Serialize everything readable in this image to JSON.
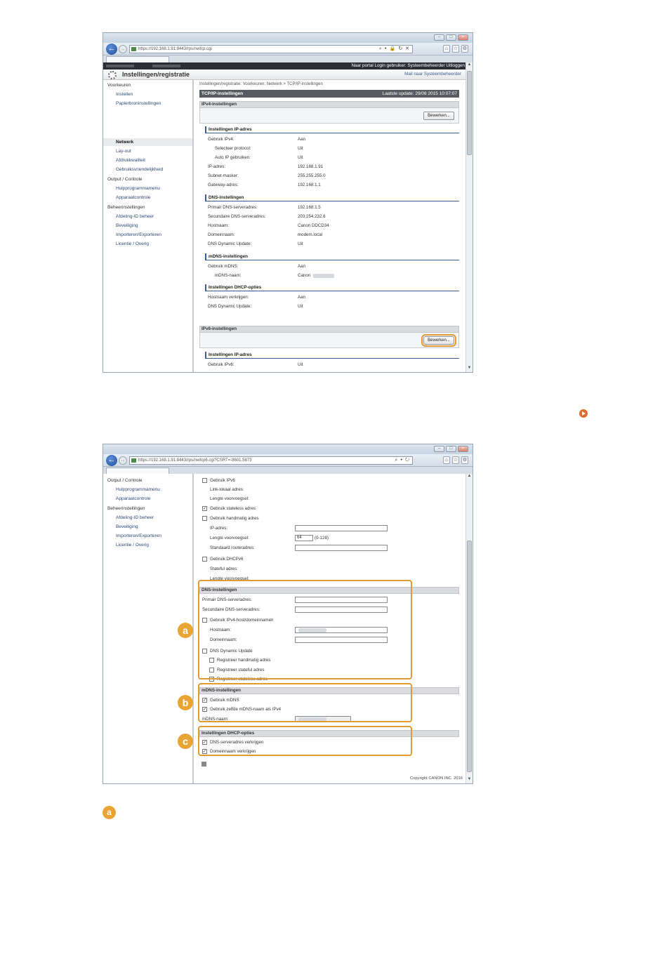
{
  "screenshot1": {
    "address": "https://192.168.1.91:8443/rps/nwtcp.cgi",
    "header_links": "Naar portal  Login gebruiker: Systeembeheerder  Uitloggen",
    "header_title": "Instellingen/registratie",
    "mail_link": "Mail naar Systeembeheerder",
    "sidebar": [
      {
        "label": "Voorkeuren",
        "type": "group"
      },
      {
        "label": "Instellen",
        "type": "item"
      },
      {
        "label": "Papierbroninstellingen",
        "type": "item"
      },
      {
        "label": "Netwerk",
        "type": "active"
      },
      {
        "label": "Lay-out",
        "type": "item"
      },
      {
        "label": "Afdrukkwaliteit",
        "type": "item"
      },
      {
        "label": "Gebruiksvriendelijkheid",
        "type": "item"
      },
      {
        "label": "Output / Controle",
        "type": "group"
      },
      {
        "label": "Hulpprogrammamenu",
        "type": "item"
      },
      {
        "label": "Apparaatcontrole",
        "type": "item"
      },
      {
        "label": "Beheerinstellingen",
        "type": "group"
      },
      {
        "label": "Afdeling-ID beheer",
        "type": "item"
      },
      {
        "label": "Beveiliging",
        "type": "item"
      },
      {
        "label": "Importeren/Exporteren",
        "type": "item"
      },
      {
        "label": "Licentie / Overig",
        "type": "item"
      }
    ],
    "breadcrumb": "Instellingen/registratie: Voorkeuren: Netwerk > TCP/IP-instellingen",
    "page_title": "TCP/IP-instellingen",
    "last_update": "Laatste update: 29/08 2015 10:07:07",
    "ipv4_section": "IPv4-instellingen",
    "edit_label": "Bewerken...",
    "ip_heading": "Instellingen IP-adres",
    "ip_rows": [
      {
        "label": "Gebruik IPv4:",
        "value": "Aan"
      },
      {
        "label": "Selecteer protocol:",
        "value": "Uit"
      },
      {
        "label": "Auto IP gebruiken:",
        "value": "Uit"
      },
      {
        "label": "IP-adres:",
        "value": "192.168.1.91"
      },
      {
        "label": "Subnet-masker:",
        "value": "255.255.255.0"
      },
      {
        "label": "Gateway-adres:",
        "value": "192.168.1.1"
      }
    ],
    "dns_heading": "DNS-instellingen",
    "dns_rows": [
      {
        "label": "Primair DNS-serveradres:",
        "value": "192.168.1.5"
      },
      {
        "label": "Secundaire DNS-serveradres:",
        "value": "203.254.232.6"
      },
      {
        "label": "Hostnaam:",
        "value": "Canon DDCD34"
      },
      {
        "label": "Domeinnaam:",
        "value": "modem.local"
      },
      {
        "label": "DNS Dynamic Update:",
        "value": "Uit"
      }
    ],
    "mdns_heading": "mDNS-instellingen",
    "mdns_rows": [
      {
        "label": "Gebruik mDNS:",
        "value": "Aan"
      },
      {
        "label": "mDNS-naam:",
        "value": "Canon"
      }
    ],
    "dhcp_heading": "Instellingen DHCP-opties",
    "dhcp_rows": [
      {
        "label": "Hostnaam verkrijgen:",
        "value": "Aan"
      },
      {
        "label": "DNS Dynamic Update:",
        "value": "Uit"
      }
    ],
    "ipv6_section": "IPv6-instellingen",
    "ip6_heading": "Instellingen IP-adres",
    "ip6_row": {
      "label": "Gebruik IPv6:",
      "value": "Uit"
    }
  },
  "screenshot2": {
    "address": "https://192.168.1.91:8443/rps/nwtcp6.cgi?CSRT=-8601.5873",
    "sidebar": [
      {
        "label": "Output / Controle",
        "type": "group"
      },
      {
        "label": "Hulpprogrammamenu",
        "type": "item"
      },
      {
        "label": "Apparaatcontrole",
        "type": "item"
      },
      {
        "label": "Beheerinstellingen",
        "type": "group"
      },
      {
        "label": "Afdeling-ID beheer",
        "type": "item"
      },
      {
        "label": "Beveiliging",
        "type": "item"
      },
      {
        "label": "Importeren/Exporteren",
        "type": "item"
      },
      {
        "label": "Licentie / Overig",
        "type": "item"
      }
    ],
    "ipv6": {
      "use_ipv6": "Gebruik IPv6",
      "link_local": "Link-lokaal adres:",
      "prefix_length1": "Lengte voorvoegsel:",
      "stateless": "Gebruik stateless adres",
      "manual": "Gebruik handmatig adres",
      "ip_address": "IP-adres:",
      "prefix_length2": "Lengte voorvoegsel:",
      "prefix_value": "64",
      "prefix_range": "(0-128)",
      "default_router": "Standaard routeradres:",
      "dhcpv6": "Gebruik DHCPv6",
      "stateful": "Stateful adres:",
      "prefix_length3": "Lengte voorvoegsel:"
    },
    "dns": {
      "heading": "DNS-instellingen",
      "primary": "Primair DNS-serveradres:",
      "secondary": "Secundaire DNS-serveradres:",
      "use_ipv4_host": "Gebruik IPv4-host/domeinnamen",
      "hostname": "Hostnaam:",
      "domain": "Domeinnaam:",
      "dynamic_update": "DNS Dynamic Update",
      "reg_manual": "Registreer handmatig adres",
      "reg_stateful": "Registreer stateful adres",
      "reg_stateless": "Registreer stateless adres"
    },
    "mdns": {
      "heading": "mDNS-instellingen",
      "use_mdns": "Gebruik mDNS",
      "same_name": "Gebruik zelfde mDNS-naam als IPv4",
      "name": "mDNS-naam:"
    },
    "dhcp": {
      "heading": "Instellingen DHCP-opties",
      "dns_server": "DNS-serveradres verkrijgen",
      "domain_name": "Domeinnaam verkrijgen"
    },
    "copyright": "Copyright CANON INC. 2016"
  },
  "markers": [
    "a",
    "b",
    "c"
  ],
  "bottom_marker": "a"
}
